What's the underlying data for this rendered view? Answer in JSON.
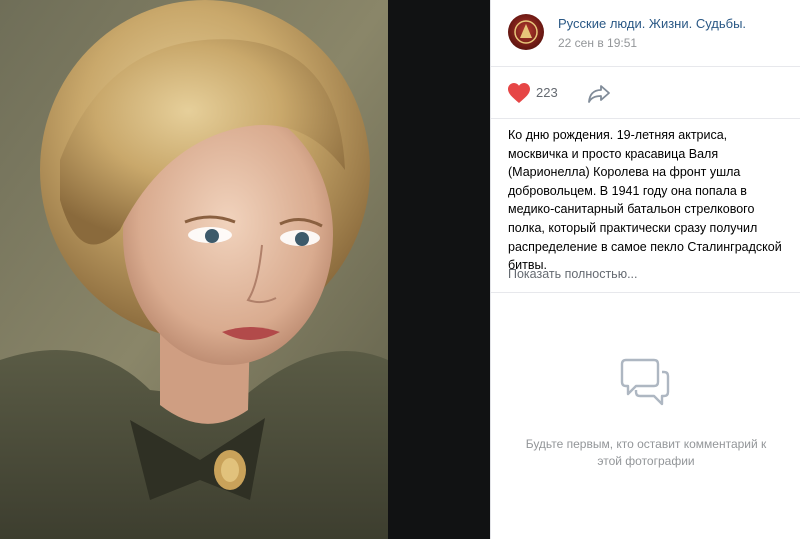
{
  "post": {
    "group_name": "Русские люди. Жизни. Судьбы.",
    "date": "22 сен в 19:51",
    "likes": "223",
    "caption": "Ко дню рождения. 19-летняя актриса, москвичка и просто красавица Валя (Марионелла) Королева на фронт ушла добровольцем. В 1941 году она попала в медико-санитарный батальон стрелкового полка, который практически сразу получил распределение в самое пекло Сталинградской битвы.",
    "show_more": "Показать полностью..."
  },
  "comments": {
    "empty_text": "Будьте первым, кто оставит комментарий к этой фотографии"
  },
  "icons": {
    "like": "heart-icon",
    "share": "share-arrow-icon",
    "comments": "speech-bubbles-icon"
  },
  "colors": {
    "like_red": "#e64646",
    "link_blue": "#2a5885",
    "muted_gray": "#939699"
  }
}
